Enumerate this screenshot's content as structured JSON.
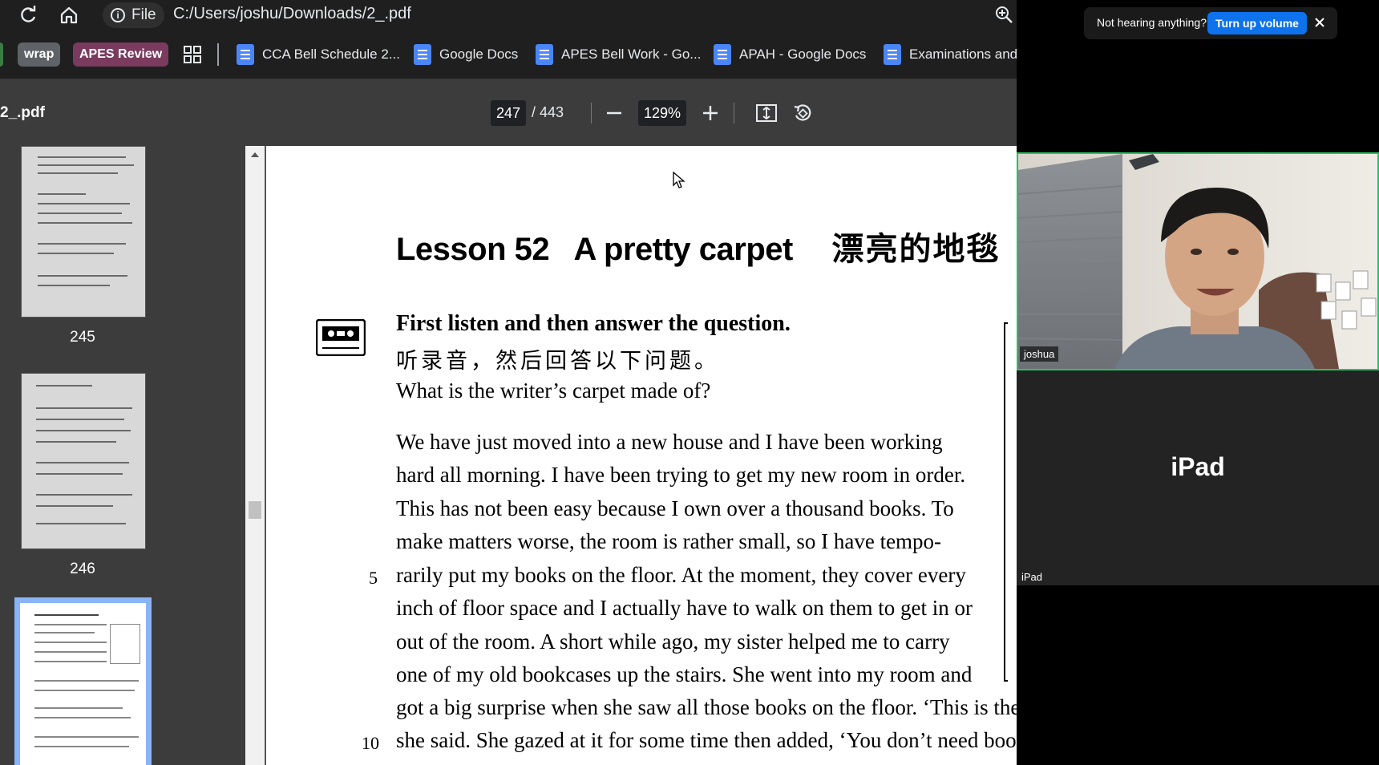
{
  "browser": {
    "address": {
      "scheme_label": "File",
      "url": "C:/Users/joshu/Downloads/2_.pdf"
    },
    "bookmarks": {
      "chips": [
        {
          "label": "wrap",
          "color": "#5f6368"
        },
        {
          "label": "APES Review",
          "color": "#7a3b5f"
        }
      ],
      "items": [
        {
          "label": "CCA Bell Schedule 2..."
        },
        {
          "label": "Google Docs"
        },
        {
          "label": "APES Bell Work - Go..."
        },
        {
          "label": "APAH - Google Docs"
        },
        {
          "label": "Examinations and"
        }
      ]
    }
  },
  "pdf": {
    "filename": "2_.pdf",
    "current_page": "247",
    "total_pages": "/ 443",
    "zoom": "129%",
    "thumbnails": [
      {
        "label": "245"
      },
      {
        "label": "246"
      },
      {
        "label": "247",
        "selected": true
      }
    ]
  },
  "document": {
    "title_en": "Lesson 52   A pretty carpet",
    "title_zh": "漂亮的地毯",
    "instruction_en": "First listen and then answer the question.",
    "instruction_zh": "听录音，然后回答以下问题。",
    "question": "What is the writer’s carpet made of?",
    "paragraph_lines": [
      "We have just moved into a new house and I have been working",
      "hard all morning. I have been trying to get my new room in order.",
      "This has not been easy because I own over a thousand books. To",
      "make matters worse, the room is rather small, so I have tempo-",
      "rarily put my books on the floor. At the moment, they cover every",
      "inch of floor space and I actually have to walk on them to get in or",
      "out of the room. A short while ago, my sister helped me to carry",
      "one of my old bookcases up the stairs. She went into my room and",
      "got a big surprise when she saw all those books on the floor. ‘This is the",
      "she said. She gazed at it for some time then added, ‘You don’t need books"
    ],
    "line_numbers": {
      "line5": "5",
      "line10": "10"
    }
  },
  "meeting": {
    "notice_text": "Not hearing anything?",
    "notice_button": "Turn up volume",
    "participant_name": "joshua",
    "ipad_title": "iPad",
    "ipad_label": "iPad",
    "active_speaker_color": "#22c55e"
  }
}
